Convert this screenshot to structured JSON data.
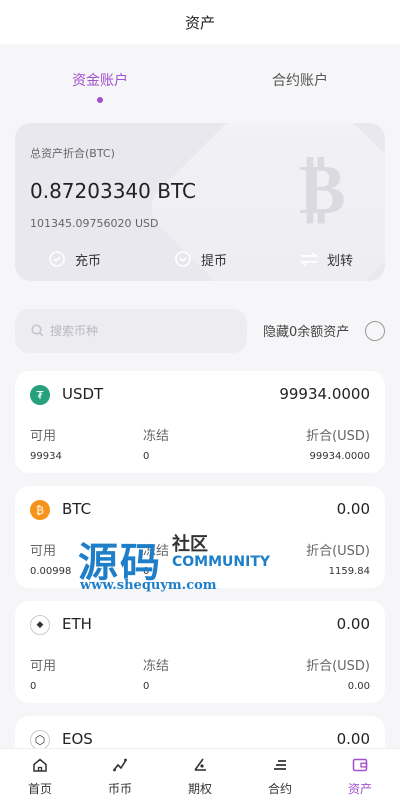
{
  "header": {
    "title": "资产"
  },
  "tabs": [
    {
      "label": "资金账户",
      "active": true
    },
    {
      "label": "合约账户",
      "active": false
    }
  ],
  "summary": {
    "label": "总资产折合(BTC)",
    "btc_value": "0.87203340 BTC",
    "usd_value": "101345.09756020 USD",
    "actions": [
      {
        "label": "充币",
        "icon": "deposit-icon"
      },
      {
        "label": "提币",
        "icon": "withdraw-icon"
      },
      {
        "label": "划转",
        "icon": "transfer-icon"
      }
    ]
  },
  "search": {
    "placeholder": "搜索币种",
    "hide_zero_label": "隐藏0余额资产",
    "hide_zero_checked": false
  },
  "columns": {
    "available": "可用",
    "frozen": "冻结",
    "converted": "折合(USD)"
  },
  "coins": [
    {
      "name": "USDT",
      "total": "99934.0000",
      "available": "99934",
      "frozen": "0",
      "converted": "99934.0000",
      "icon": "usdt-icon",
      "color": "#26a17b",
      "glyph": "₮"
    },
    {
      "name": "BTC",
      "total": "0.00",
      "available": "0.00998",
      "frozen": "0",
      "converted": "1159.84",
      "icon": "btc-icon",
      "color": "#f7931a",
      "glyph": "₿"
    },
    {
      "name": "ETH",
      "total": "0.00",
      "available": "0",
      "frozen": "0",
      "converted": "0.00",
      "icon": "eth-icon",
      "color": "#ffffff",
      "glyph": "◆"
    },
    {
      "name": "EOS",
      "total": "0.00",
      "icon": "eos-icon",
      "color": "#ffffff",
      "glyph": "⬡"
    }
  ],
  "watermark": {
    "main": "源码",
    "cn": "社区",
    "en": "COMMUNITY",
    "url": "www.shequym.com"
  },
  "bottom_nav": [
    {
      "label": "首页",
      "icon": "home-icon",
      "active": false
    },
    {
      "label": "币币",
      "icon": "coin-trade-icon",
      "active": false
    },
    {
      "label": "期权",
      "icon": "options-icon",
      "active": false
    },
    {
      "label": "合约",
      "icon": "contract-icon",
      "active": false
    },
    {
      "label": "资产",
      "icon": "wallet-icon",
      "active": true
    }
  ],
  "colors": {
    "accent": "#a24fd0",
    "card_bg": "#e8e8ee",
    "page_bg": "#f6f6f8"
  }
}
